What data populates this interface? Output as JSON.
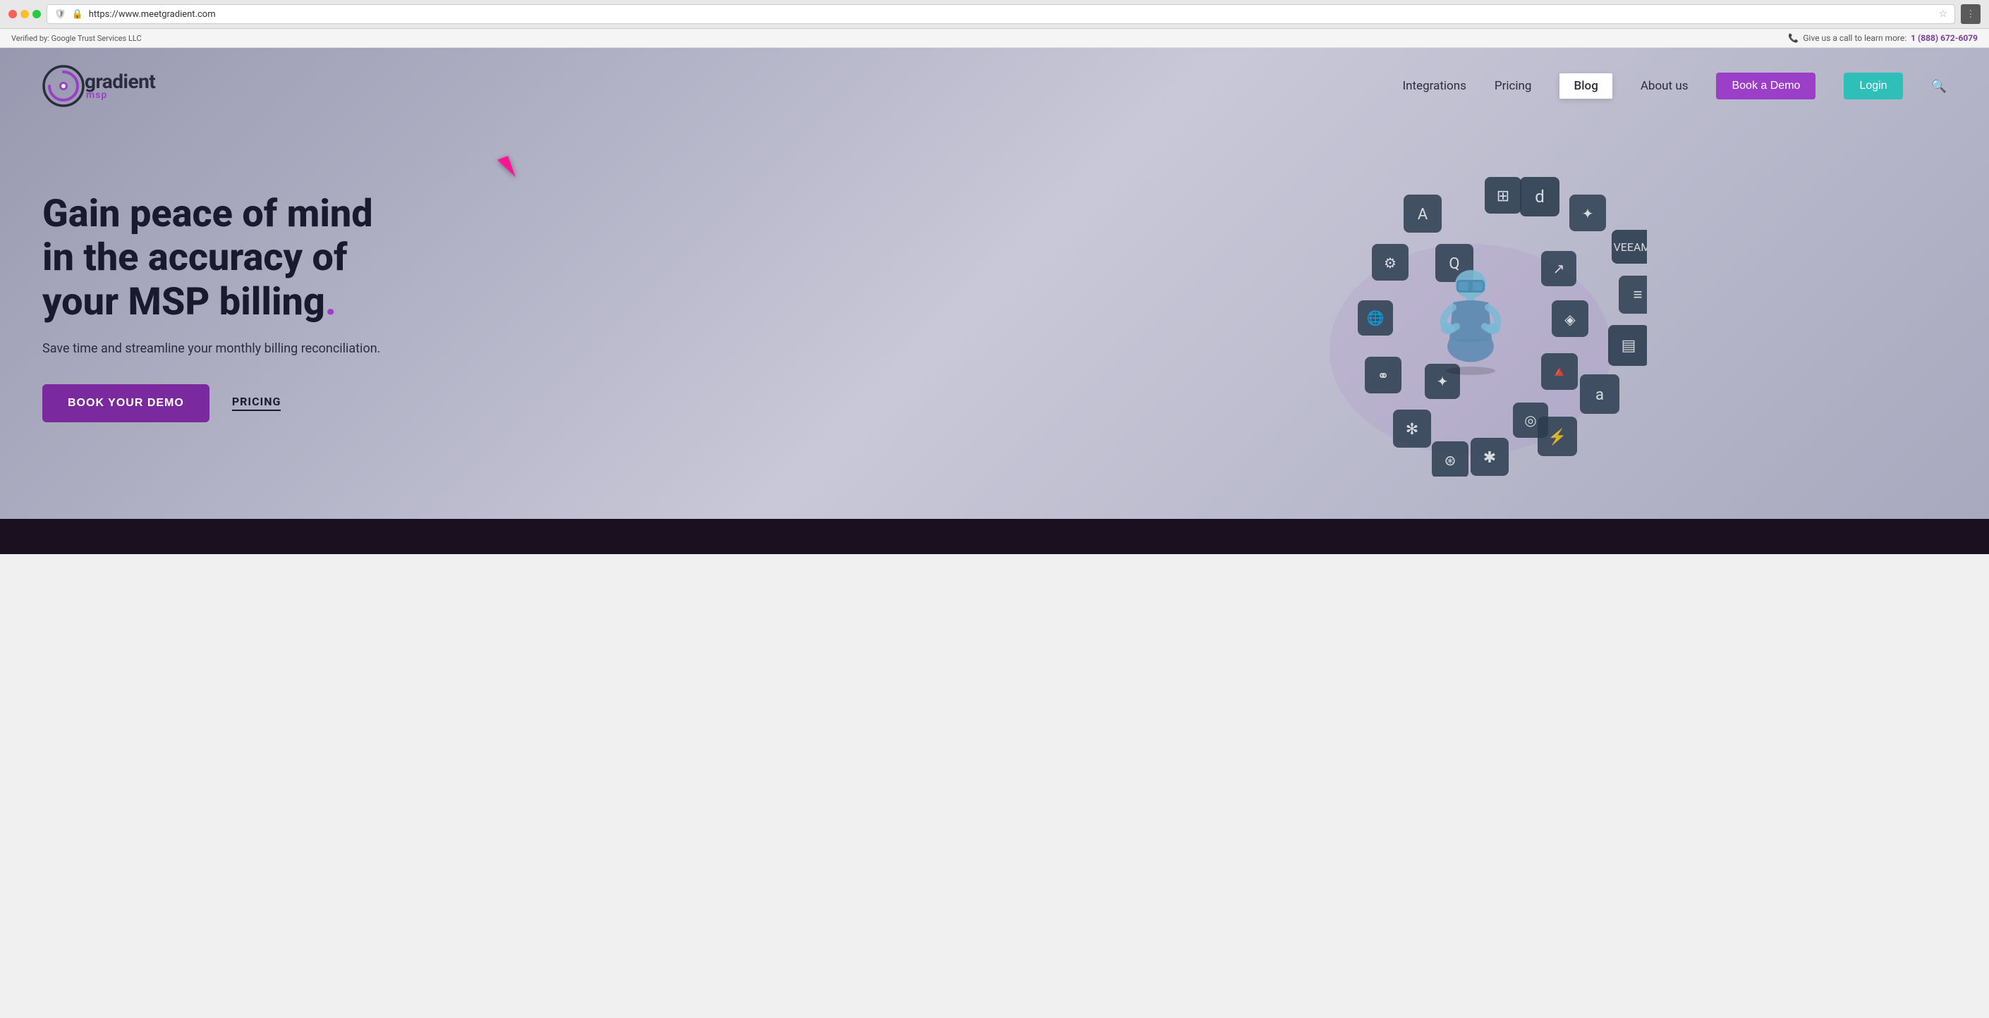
{
  "browser": {
    "url": "https://www.meetgradient.com",
    "verified_text": "Verified by: Google Trust Services LLC",
    "action_buttons": [
      "←",
      "→",
      "↻"
    ]
  },
  "security_bar": {
    "verified_label": "Verified by: Google Trust Services LLC",
    "call_label": "Give us a call to learn more:",
    "phone": "1 (888) 672-6079"
  },
  "nav": {
    "logo_name": "gradient",
    "logo_sub": "msp",
    "links": [
      {
        "label": "Integrations",
        "active": false
      },
      {
        "label": "Pricing",
        "active": false
      },
      {
        "label": "Blog",
        "active": true
      },
      {
        "label": "About us",
        "active": false
      }
    ],
    "book_demo_label": "Book a Demo",
    "login_label": "Login"
  },
  "hero": {
    "title_line1": "Gain peace of mind",
    "title_line2": "in the accuracy of",
    "title_line3": "your MSP billing",
    "title_dot": ".",
    "subtitle": "Save time and streamline your monthly billing reconciliation.",
    "cta_primary": "BOOK YOUR DEMO",
    "cta_secondary": "PRICING"
  },
  "footer_bar": {}
}
